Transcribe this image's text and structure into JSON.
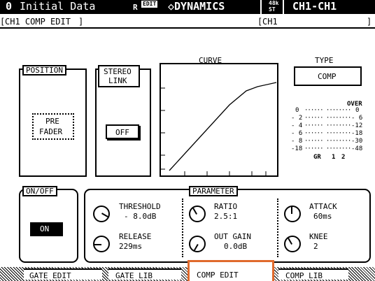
{
  "header": {
    "scene_number": "0",
    "scene_name": "Initial Data",
    "edit_badge": "EDIT",
    "edit_prefix": "R",
    "section": "◇DYNAMICS",
    "rate_top": "48k",
    "rate_bottom": "ST",
    "channel": "CH1-CH1"
  },
  "subheader": {
    "page_title": "CH1 COMP EDIT",
    "channel_name": "CH1"
  },
  "position": {
    "label": "POSITION",
    "value_line1": "PRE",
    "value_line2": "FADER"
  },
  "stereo_link": {
    "label_line1": "STEREO",
    "label_line2": "LINK",
    "value": "OFF"
  },
  "curve": {
    "label": "CURVE"
  },
  "type": {
    "label": "TYPE",
    "value": "COMP"
  },
  "meter": {
    "left_scale": [
      "0",
      "- 2",
      "- 4",
      "- 6",
      "- 8",
      "-18"
    ],
    "right_scale": [
      "OVER",
      "0",
      "- 6",
      "-12",
      "-18",
      "-30",
      "-48"
    ],
    "foot": [
      "GR",
      "1",
      "2"
    ]
  },
  "on_off": {
    "label": "ON/OFF",
    "value": "ON"
  },
  "parameter": {
    "label": "PARAMETER",
    "threshold": {
      "label": "THRESHOLD",
      "value": "- 8.0dB"
    },
    "release": {
      "label": "RELEASE",
      "value": "229ms"
    },
    "ratio": {
      "label": "RATIO",
      "value": "2.5:1"
    },
    "out_gain": {
      "label": "OUT GAIN",
      "value": "0.0dB"
    },
    "attack": {
      "label": "ATTACK",
      "value": "60ms"
    },
    "knee": {
      "label": "KNEE",
      "value": "2"
    }
  },
  "tabs": [
    "GATE EDIT",
    "GATE LIB",
    "COMP EDIT",
    "COMP LIB"
  ],
  "active_tab": "COMP EDIT",
  "colors": {
    "highlight": "#e06a2c",
    "ink": "#000000",
    "paper": "#ffffff"
  }
}
